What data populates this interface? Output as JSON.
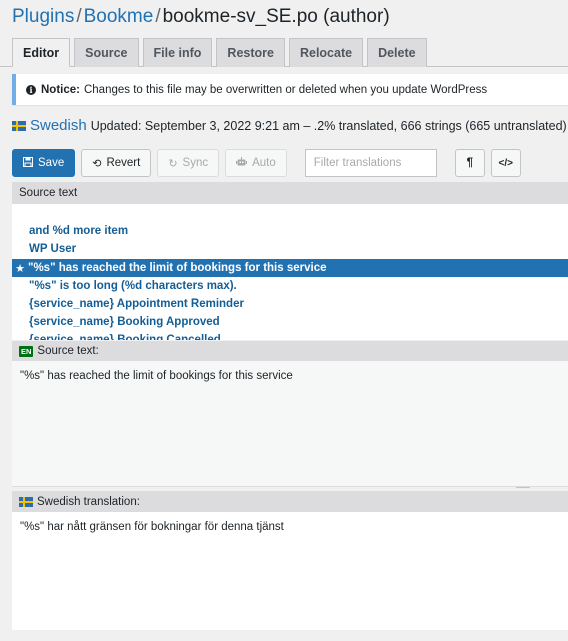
{
  "breadcrumb": {
    "plugins": "Plugins",
    "plugin": "Bookme",
    "file": "bookme-sv_SE.po (author)",
    "separator": "/"
  },
  "tabs": [
    "Editor",
    "Source",
    "File info",
    "Restore",
    "Relocate",
    "Delete"
  ],
  "notice": {
    "label": "Notice:",
    "text": "Changes to this file may be overwritten or deleted when you update WordPress"
  },
  "language": {
    "name": "Swedish",
    "status": "Updated: September 3, 2022 9:21 am – .2% translated, 666 strings (665 untranslated)"
  },
  "toolbar": {
    "save": "Save",
    "revert": "Revert",
    "sync": "Sync",
    "auto": "Auto",
    "filter_placeholder": "Filter translations",
    "pilcrow": "¶",
    "code": "</>"
  },
  "source_list": {
    "header": "Source text",
    "rows": [
      "and %d more item",
      "WP User",
      "\"%s\" has reached the limit of bookings for this service",
      "\"%s\" is too long (%d characters max).",
      "{service_name} Appointment Reminder",
      "{service_name} Booking Approved",
      "{service_name} Booking Cancelled"
    ],
    "selected_index": 2
  },
  "source_panel": {
    "badge": "EN",
    "label": "Source text:",
    "text": "\"%s\" has reached the limit of bookings for this service"
  },
  "translation_panel": {
    "label": "Swedish translation:",
    "text": "\"%s\" har nått gränsen för bokningar för denna tjänst"
  },
  "colors": {
    "link": "#2271b1",
    "selected_row": "#2271b1",
    "notice_border": "#72aee6",
    "en_badge": "#007017"
  },
  "icons": [
    "info-icon",
    "flag-sweden-icon",
    "save-icon",
    "revert-icon",
    "sync-icon",
    "robot-icon",
    "star-icon"
  ]
}
